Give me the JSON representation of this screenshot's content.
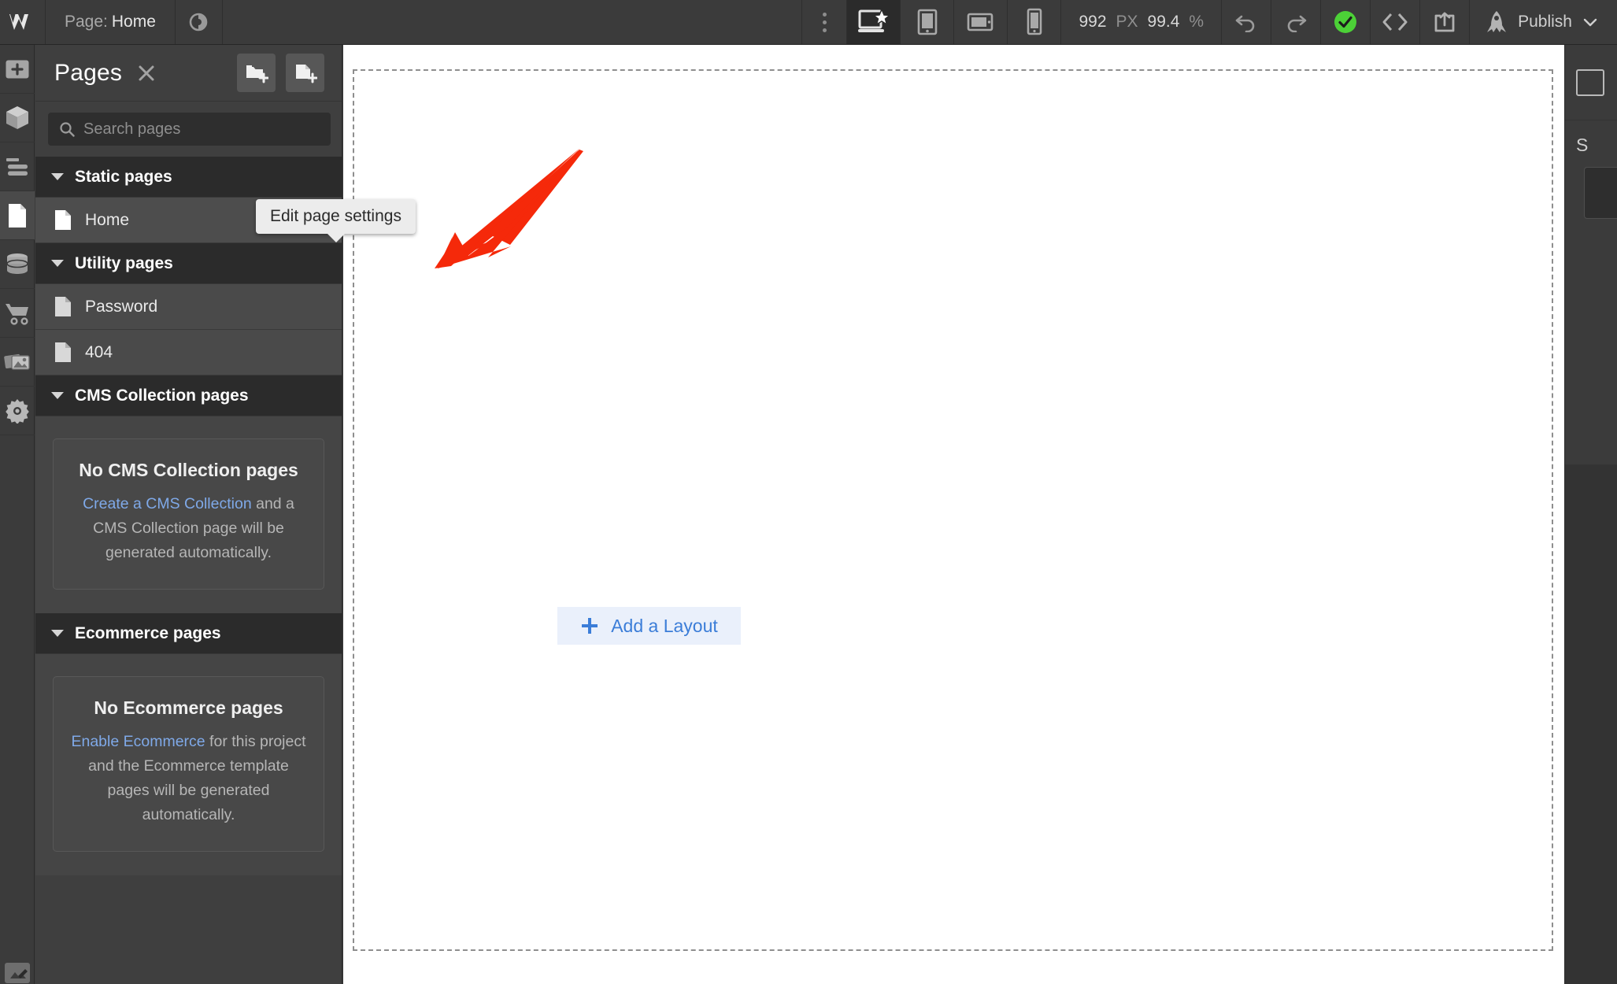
{
  "topbar": {
    "logo_icon": "webflow-logo-icon",
    "page_prefix": "Page:",
    "page_name": "Home",
    "preview_icon": "eye-preview-icon",
    "kebab_icon": "more-options-icon",
    "breakpoints": [
      {
        "icon": "desktop-starred-icon",
        "label": "Desktop",
        "active": true
      },
      {
        "icon": "tablet-icon",
        "label": "Tablet",
        "active": false
      },
      {
        "icon": "tablet-landscape-icon",
        "label": "Mobile landscape",
        "active": false
      },
      {
        "icon": "mobile-icon",
        "label": "Mobile portrait",
        "active": false
      }
    ],
    "viewport_width": "992",
    "viewport_unit": "PX",
    "zoom_value": "99.4",
    "zoom_unit": "%",
    "undo_icon": "undo-icon",
    "redo_icon": "redo-icon",
    "saved_icon": "saved-check-icon",
    "saved_color": "#4cd137",
    "code_icon": "code-brackets-icon",
    "share_icon": "share-export-icon",
    "rocket_icon": "rocket-icon",
    "publish_label": "Publish",
    "publish_caret_icon": "chevron-down-icon"
  },
  "rail": {
    "items": [
      {
        "icon": "add-elements-icon",
        "name": "add-panel",
        "active": false
      },
      {
        "icon": "components-cube-icon",
        "name": "components-panel",
        "active": false
      },
      {
        "icon": "navigator-layers-icon",
        "name": "navigator-panel",
        "active": false
      },
      {
        "icon": "pages-document-icon",
        "name": "pages-panel",
        "active": true
      },
      {
        "icon": "cms-database-icon",
        "name": "cms-panel",
        "active": false
      },
      {
        "icon": "ecommerce-cart-icon",
        "name": "ecommerce-panel",
        "active": false
      },
      {
        "icon": "assets-images-icon",
        "name": "assets-panel",
        "active": false
      },
      {
        "icon": "settings-gear-icon",
        "name": "settings-panel",
        "active": false
      }
    ],
    "bottom_icon": "edit-pencil-icon"
  },
  "pages_panel": {
    "title": "Pages",
    "close_icon": "close-x-icon",
    "new_folder_icon": "new-folder-icon",
    "new_page_icon": "new-page-icon",
    "search_icon": "search-icon",
    "search_placeholder": "Search pages",
    "search_value": "",
    "sections": [
      {
        "label": "Static pages",
        "caret_icon": "caret-down-icon",
        "pages": [
          {
            "name": "Home",
            "icon": "page-document-icon",
            "selected": true,
            "home_icon": "home-icon",
            "settings_icon": "gear-settings-icon"
          }
        ]
      },
      {
        "label": "Utility pages",
        "caret_icon": "caret-down-icon",
        "pages": [
          {
            "name": "Password",
            "icon": "page-document-icon",
            "selected": false
          },
          {
            "name": "404",
            "icon": "page-document-icon",
            "selected": false
          }
        ]
      },
      {
        "label": "CMS Collection pages",
        "caret_icon": "caret-down-icon",
        "empty": {
          "title": "No CMS Collection pages",
          "link_text": "Create a CMS Collection",
          "body_text": " and a CMS Collection page will be generated automatically."
        }
      },
      {
        "label": "Ecommerce pages",
        "caret_icon": "caret-down-icon",
        "empty": {
          "title": "No Ecommerce pages",
          "link_text": "Enable Ecommerce",
          "body_text": " for this project and the Ecommerce template pages will be generated automatically."
        }
      }
    ]
  },
  "tooltip": {
    "text": "Edit page settings"
  },
  "canvas": {
    "add_layout_label": "Add a Layout",
    "add_layout_icon": "plus-icon",
    "add_layout_color": "#3b7dd8",
    "add_layout_bg": "#eaf0fb"
  },
  "annotation": {
    "arrow_color": "#f5290a",
    "arrow_points_to": "gear-settings-icon"
  },
  "colors": {
    "topbar_bg": "#3b3b3b",
    "panel_bg": "#3f3f3f",
    "section_header_bg": "#2b2b2b",
    "row_bg": "#4a4a4a",
    "canvas_bg": "#ffffff",
    "link_blue": "#7fa9e8",
    "saved_green": "#4cd137"
  }
}
